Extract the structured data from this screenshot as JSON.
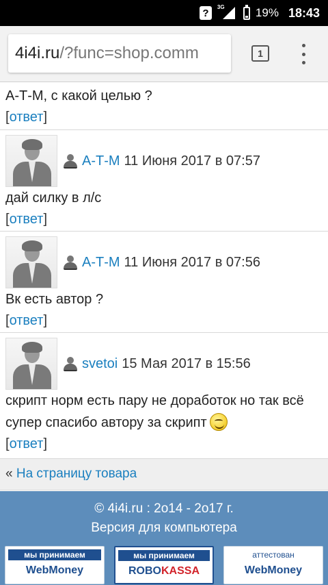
{
  "status_bar": {
    "network": "3G",
    "battery": "19%",
    "time": "18:43"
  },
  "browser": {
    "url_host": "4i4i.ru",
    "url_path": "/?func=shop.comm",
    "tab_count": "1"
  },
  "comments": [
    {
      "text": "А-Т-М, с какой целью ?",
      "reply_open": "[",
      "reply_label": "ответ",
      "reply_close": "]"
    },
    {
      "author": "А-Т-М",
      "date": "11 Июня 2017 в 07:57",
      "text": "дай силку в л/с",
      "reply_open": "[",
      "reply_label": "ответ",
      "reply_close": "]"
    },
    {
      "author": "А-Т-М",
      "date": "11 Июня 2017 в 07:56",
      "text": "Вк есть автор ?",
      "reply_open": "[",
      "reply_label": "ответ",
      "reply_close": "]"
    },
    {
      "author": "svetoi",
      "date": "15 Мая 2017 в 15:56",
      "text": "скрипт норм есть пару не доработок но так всё супер спасибо автору за скрипт",
      "reply_open": "[",
      "reply_label": "ответ",
      "reply_close": "]"
    }
  ],
  "back_link": {
    "prefix": "«",
    "label": "На страницу товара"
  },
  "footer": {
    "copyright": "© 4i4i.ru : 2o14 - 2o17 г.",
    "desktop_version": "Версия для компьютера"
  },
  "badges": [
    {
      "top": "мы принимаем",
      "brand": "WebMoney"
    },
    {
      "top": "мы принимаем",
      "brand_1": "ROBO",
      "brand_2": "KASSA"
    },
    {
      "top": "аттестован",
      "brand": "WebMoney"
    }
  ]
}
